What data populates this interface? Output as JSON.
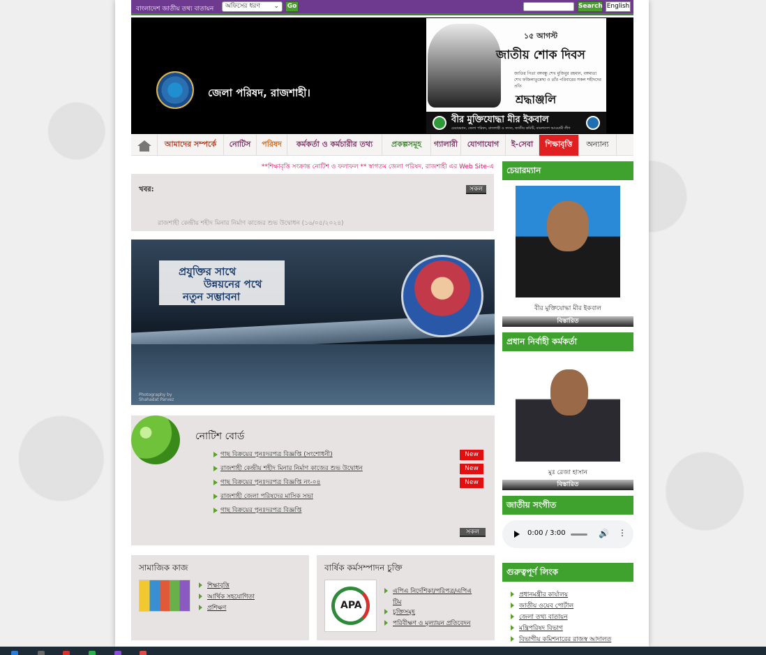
{
  "topbar": {
    "portal_label": "বাংলাদেশ জাতীয় তথ্য বাতায়ন",
    "office_select_value": "অফিসের ধরণ",
    "go_label": "Go",
    "search_placeholder": "",
    "search_label": "Search",
    "language_label": "English"
  },
  "header": {
    "site_title": "জেলা পরিষদ, রাজশাহী।",
    "banner": {
      "date_line": "১৫ আগস্ট",
      "event_title": "জাতীয় শোক দিবস",
      "event_sub": "জাতির পিতা বঙ্গবন্ধু শেখ মুজিবুর রহমান, বঙ্গমাতা শেখ ফজিলাতুন্নেছা ও তাঁর পরিবারের সকল শহীদদের প্রতি",
      "tribute": "শ্রদ্ধাঞ্জলি",
      "strip_name": "বীর মুক্তিযোদ্ধা মীর ইকবাল",
      "strip_sub": "চেয়ারম্যান, জেলা পরিষদ, রাজশাহী ও সদস্য, জাতীয় কমিটি, বাংলাদেশ আওয়ামী লীগ"
    }
  },
  "nav": {
    "items": [
      {
        "label": "আমাদের সম্পর্কে"
      },
      {
        "label": "নোটিস"
      },
      {
        "label": "পরিষদ"
      },
      {
        "label": "কর্মকর্তা ও কর্মচারীর তথ্য"
      },
      {
        "label": "প্রকল্পসমূহ"
      },
      {
        "label": "গ্যালারী"
      },
      {
        "label": "যোগাযোগ"
      },
      {
        "label": "ই-সেবা"
      },
      {
        "label": "শিক্ষাবৃত্তি"
      },
      {
        "label": "অন্যান্য"
      }
    ]
  },
  "marquee_text": "**শিক্ষাবৃত্তি সংক্রান্ত নোটিশ ও ফলাফল ** স্বাগতম জেলা পরিষদ, রাজশাহী এর Web Site-এ",
  "news": {
    "label": "খবর:",
    "all_label": "সকল",
    "item": "রাজশাহী কেন্দ্রীয় শহীদ মিনার নির্মাণ কাজের শুভ উদ্বোধন (১৬/০৫/২০২৪)"
  },
  "hero": {
    "slogan_line1": "প্রযুক্তির সাথে",
    "slogan_line2": "উন্নয়নের পথে",
    "slogan_line3": "নতুন সম্ভাবনা",
    "photo_credit_1": "Photography by",
    "photo_credit_2": "Shahadat Parvez"
  },
  "notice_board": {
    "title": "নোটিশ বোর্ড",
    "all_label": "সকল",
    "items": [
      {
        "text": "গাছ বিক্রয়ের পুনঃদরপত্র বিজ্ঞপ্তি (সংশোধনী)",
        "badge": "New"
      },
      {
        "text": "রাজশাহী কেন্দ্রীয় শহীদ মিনার নির্মাণ কাজের শুভ উদ্বোধন",
        "badge": "New"
      },
      {
        "text": "গাছ বিক্রয়ের পুনঃদরপত্র বিজ্ঞপ্তি নং-০৪",
        "badge": "New"
      },
      {
        "text": "রাজশাহী জেলা পরিষদের মাসিক সভা",
        "badge": ""
      },
      {
        "text": "গাছ বিক্রয়ের পুনঃদরপত্র বিজ্ঞপ্তি",
        "badge": ""
      }
    ]
  },
  "social_work": {
    "title": "সামাজিক কাজ",
    "links": [
      "শিক্ষাবৃত্তি",
      "আর্থিক সহযোগিতা",
      "প্রশিক্ষণ"
    ]
  },
  "apa": {
    "title": "বার্ষিক কর্মসম্পাদন চুক্তি",
    "logo_text": "APA",
    "links": [
      "এপিএ নির্দেশিকা/পরিপত্র/এপিএ",
      "টিম",
      "চুক্তিসমূহ",
      "পরিবীক্ষণ ও মূল্যায়ন প্রতিবেদন"
    ]
  },
  "sidebar": {
    "chairman_heading": "চেয়ারম্যান",
    "chairman_name": "বীর মুক্তিযোদ্ধা মীর ইকবাল",
    "details_label": "বিস্তারিত",
    "ceo_heading": "প্রধান নির্বাহী কর্মকর্তা",
    "ceo_name": "মুঃ রেজা হাসান",
    "anthem_heading": "জাতীয় সংগীত",
    "audio_time": "0:00 / 3:00",
    "links_heading": "গুরুত্বপূর্ণ লিংক",
    "links": [
      "প্রধানমন্ত্রীর কার্যালয়",
      "জাতীয় ওয়েব পোর্টাল",
      "জেলা তথ্য বাতায়ন",
      "মন্ত্রিপরিষদ বিভাগ",
      "বিভাগীয় কমিশনারের রাজস্ব আদালত"
    ]
  },
  "colors": {
    "topbar": "#6d3a8f",
    "accent_green": "#3fa22e",
    "new_badge": "#e01010",
    "active_nav": "#e02020"
  }
}
